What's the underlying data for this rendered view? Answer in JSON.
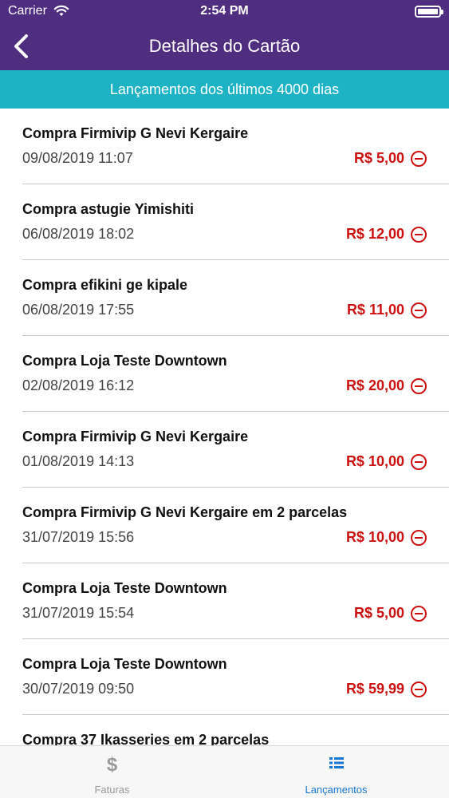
{
  "status_bar": {
    "carrier": "Carrier",
    "time": "2:54 PM"
  },
  "nav": {
    "title": "Detalhes do Cartão",
    "back_icon": "chevron-left-icon"
  },
  "subheader": {
    "text": "Lançamentos dos últimos 4000 dias"
  },
  "transactions": [
    {
      "title": "Compra Firmivip G Nevi Kergaire",
      "date": "09/08/2019 11:07",
      "amount": "R$ 5,00"
    },
    {
      "title": "Compra astugie Yimishiti",
      "date": "06/08/2019 18:02",
      "amount": "R$ 12,00"
    },
    {
      "title": "Compra efikini ge kipale",
      "date": "06/08/2019 17:55",
      "amount": "R$ 11,00"
    },
    {
      "title": "Compra Loja Teste Downtown",
      "date": "02/08/2019 16:12",
      "amount": "R$ 20,00"
    },
    {
      "title": "Compra Firmivip G Nevi Kergaire",
      "date": "01/08/2019 14:13",
      "amount": "R$ 10,00"
    },
    {
      "title": "Compra Firmivip G Nevi Kergaire em 2 parcelas",
      "date": "31/07/2019 15:56",
      "amount": "R$ 10,00"
    },
    {
      "title": "Compra Loja Teste Downtown",
      "date": "31/07/2019 15:54",
      "amount": "R$ 5,00"
    },
    {
      "title": "Compra Loja Teste Downtown",
      "date": "30/07/2019 09:50",
      "amount": "R$ 59,99"
    },
    {
      "title": "Compra 37 Ikasseries em 2 parcelas",
      "date": "",
      "amount": ""
    }
  ],
  "tabs": [
    {
      "label": "Faturas",
      "icon": "dollar-icon",
      "active": false
    },
    {
      "label": "Lançamentos",
      "icon": "list-icon",
      "active": true
    }
  ],
  "colors": {
    "header": "#4f2d7f",
    "subheader": "#1db3c4",
    "amount": "#cc1111",
    "tab_active": "#1976d2"
  }
}
